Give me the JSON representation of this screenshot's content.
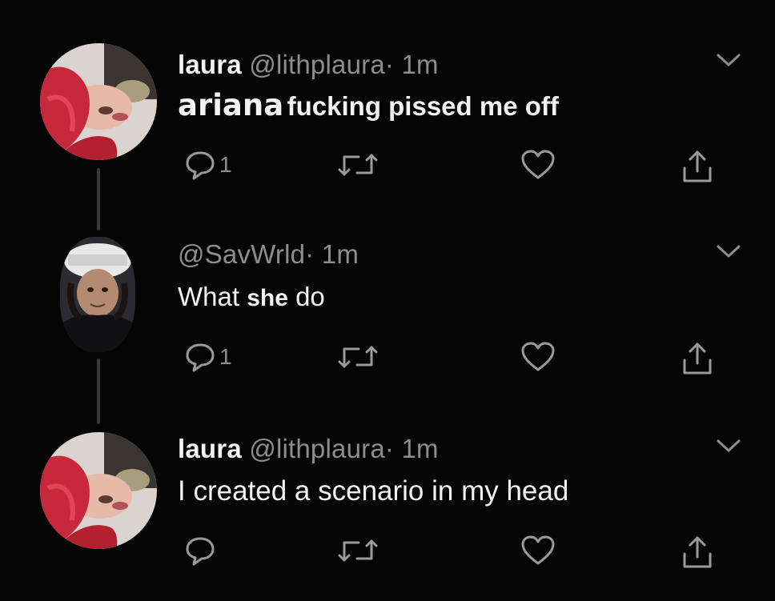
{
  "tweets": [
    {
      "display_name": "laura",
      "handle": "@lithplaura",
      "dot": "·",
      "time": "1m",
      "text_part1": "ariana",
      "text_part2": "fucking pissed me off",
      "reply_count": "1"
    },
    {
      "display_name": "",
      "handle": "@SavWrld",
      "dot": "·",
      "time": "1m",
      "text_part1": "What",
      "text_part2": "she",
      "text_part3": "do",
      "reply_count": "1"
    },
    {
      "display_name": "laura",
      "handle": "@lithplaura",
      "dot": "·",
      "time": "1m",
      "text": "I created a scenario in my head",
      "reply_count": ""
    }
  ],
  "icons": {
    "reply": "reply-icon",
    "retweet": "retweet-icon",
    "like": "heart-icon",
    "share": "share-icon",
    "more": "chevron-down-icon"
  },
  "colors": {
    "background": "#050505",
    "icon_gray": "#9a9a9a",
    "handle_gray": "#8d8d8d",
    "text_white": "#f2f2f2",
    "avatar_hair_red": "#c8283c"
  }
}
